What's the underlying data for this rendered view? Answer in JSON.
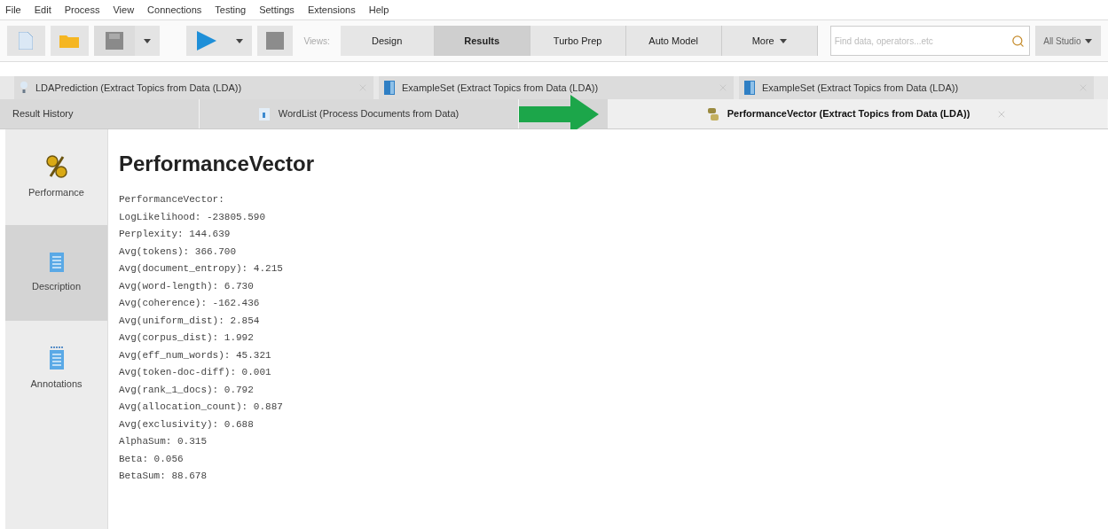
{
  "menu_bar": [
    "File",
    "Edit",
    "Process",
    "View",
    "Connections",
    "Testing",
    "Settings",
    "Extensions",
    "Help"
  ],
  "toolbar": {
    "views_label": "Views:",
    "views": [
      {
        "label": "Design",
        "selected": false
      },
      {
        "label": "Results",
        "selected": true
      },
      {
        "label": "Turbo Prep",
        "selected": false
      },
      {
        "label": "Auto Model",
        "selected": false
      },
      {
        "label": "More",
        "selected": false
      }
    ],
    "search": {
      "placeholder": "Find data, operators...etc"
    },
    "scope": "All Studio"
  },
  "result_tabs_top": [
    {
      "label": "LDAPrediction (Extract Topics from Data (LDA))",
      "kind": "model"
    },
    {
      "label": "ExampleSet (Extract Topics from Data (LDA))",
      "kind": "table"
    },
    {
      "label": "ExampleSet (Extract Topics from Data (LDA))",
      "kind": "table"
    }
  ],
  "result_tabs_bottom": [
    {
      "label": "Result History",
      "kind": "history",
      "selected": false
    },
    {
      "label": "WordList (Process Documents from Data)",
      "kind": "wordlist",
      "selected": false
    },
    {
      "label": "PerformanceVector (Extract Topics from Data (LDA))",
      "kind": "performance",
      "selected": true
    }
  ],
  "side_views": [
    {
      "label": "Performance",
      "kind": "performance",
      "selected": false
    },
    {
      "label": "Description",
      "kind": "description",
      "selected": true
    },
    {
      "label": "Annotations",
      "kind": "annotations",
      "selected": false
    }
  ],
  "content": {
    "title": "PerformanceVector",
    "lines": [
      "PerformanceVector:",
      "LogLikelihood: -23805.590",
      "Perplexity: 144.639",
      "Avg(tokens): 366.700",
      "Avg(document_entropy): 4.215",
      "Avg(word-length): 6.730",
      "Avg(coherence): -162.436",
      "Avg(uniform_dist): 2.854",
      "Avg(corpus_dist): 1.992",
      "Avg(eff_num_words): 45.321",
      "Avg(token-doc-diff): 0.001",
      "Avg(rank_1_docs): 0.792",
      "Avg(allocation_count): 0.887",
      "Avg(exclusivity): 0.688",
      "AlphaSum: 0.315",
      "Beta: 0.056",
      "BetaSum: 88.678"
    ]
  }
}
